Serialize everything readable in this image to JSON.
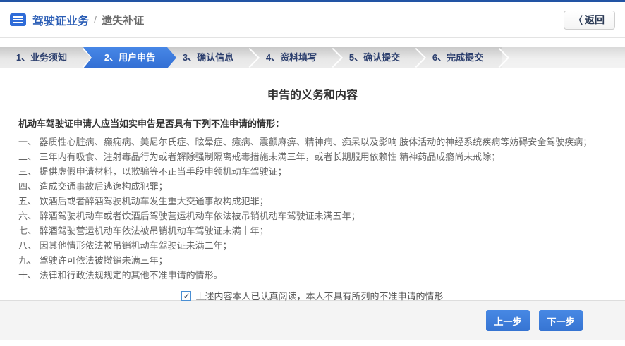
{
  "header": {
    "title": "驾驶证业务",
    "separator": "/",
    "subtitle": "遗失补证",
    "back_chevron": "〈",
    "back_label": "返回"
  },
  "steps": [
    {
      "label": "1、业务须知",
      "active": false
    },
    {
      "label": "2、用户申告",
      "active": true
    },
    {
      "label": "3、确认信息",
      "active": false
    },
    {
      "label": "4、资料填写",
      "active": false
    },
    {
      "label": "5、确认提交",
      "active": false
    },
    {
      "label": "6、完成提交",
      "active": false
    }
  ],
  "main": {
    "title": "申告的义务和内容",
    "intro": "机动车驾驶证申请人应当如实申告是否具有下列不准申请的情形：",
    "items": [
      "一、 器质性心脏病、癫痫病、美尼尔氏症、眩晕症、癔病、震颤麻痹、精神病、痴呆以及影响 肢体活动的神经系统疾病等妨碍安全驾驶疾病；",
      "二、 三年内有吸食、注射毒品行为或者解除强制隔离戒毒措施未满三年，或者长期服用依赖性 精神药品成瘾尚未戒除；",
      "三、 提供虚假申请材料，以欺骗等不正当手段申领机动车驾驶证；",
      "四、 造成交通事故后逃逸构成犯罪；",
      "五、 饮酒后或者醉酒驾驶机动车发生重大交通事故构成犯罪；",
      "六、 醉酒驾驶机动车或者饮酒后驾驶营运机动车依法被吊销机动车驾驶证未满五年；",
      "七、 醉酒驾驶营运机动车依法被吊销机动车驾驶证未满十年；",
      "八、 因其他情形依法被吊销机动车驾驶证未满二年；",
      "九、 驾驶许可依法被撤销未满三年；",
      "十、 法律和行政法规规定的其他不准申请的情形。"
    ],
    "checkbox_checked": true,
    "check_glyph": "✓",
    "checkbox_label": "上述内容本人已认真阅读，本人不具有所列的不准申请的情形"
  },
  "footer": {
    "prev_label": "上一步",
    "next_label": "下一步"
  },
  "colors": {
    "brand_blue": "#2254a4",
    "title_blue": "#2a5db5",
    "active_step_blue": "#3b7de2",
    "step_text_navy": "#2c3f6e",
    "button_blue": "#3d7edb",
    "footer_gray": "#f4f4f4",
    "text_gray": "#666666",
    "checkbox_border_blue": "#4a8fd4"
  }
}
